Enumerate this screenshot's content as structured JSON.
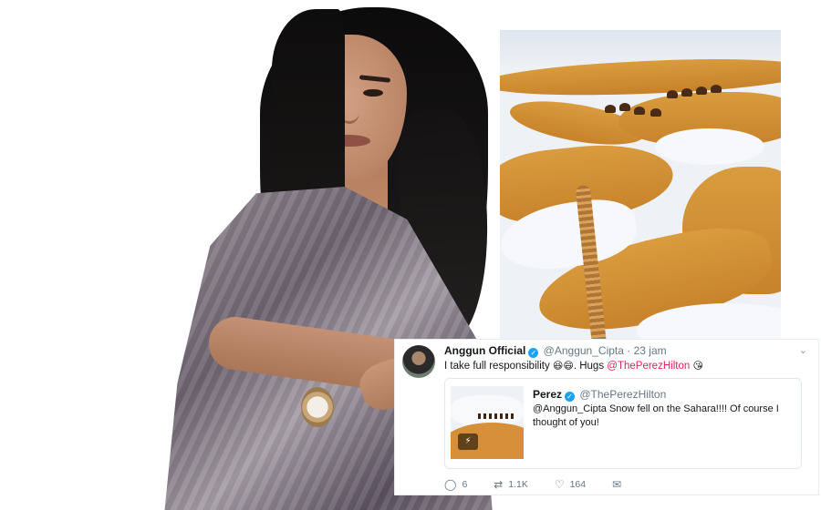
{
  "tweet": {
    "author_name": "Anggun Official",
    "author_handle": "@Anggun_Cipta",
    "separator": "·",
    "time": "23 jam",
    "text_before": "I take full responsibility",
    "text_middle": ". Hugs",
    "mention": "@ThePerezHilton",
    "emoji_laugh": "😆",
    "emoji_grin": "😄",
    "emoji_kiss": "😘",
    "caret_icon": "chevron-down-icon"
  },
  "quoted_tweet": {
    "author_name": "Perez",
    "author_handle": "@ThePerezHilton",
    "text": "@Anggun_Cipta Snow fell on the Sahara!!!! Of course I thought of you!",
    "gif_badge_icon": "gif-play-icon"
  },
  "actions": {
    "replies": "6",
    "retweets": "1.1K",
    "likes": "164"
  },
  "colors": {
    "verified": "#1da1f2",
    "mention": "#e0245e",
    "meta": "#657786"
  }
}
